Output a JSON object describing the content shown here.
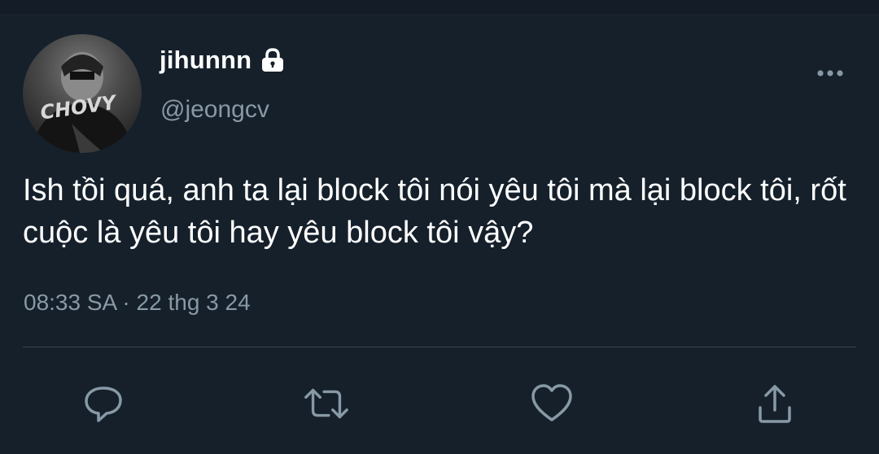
{
  "tweet": {
    "display_name": "jihunnn",
    "handle": "@jeongcv",
    "text": "Ish tồi quá, anh ta lại block tôi nói yêu tôi mà lại block tôi, rốt cuộc là yêu tôi hay yêu block tôi vậy?",
    "timestamp": "08:33 SA · 22 thg 3 24",
    "avatar_text": "CHOVY"
  },
  "icons": {
    "lock": "lock-icon",
    "more": "more-horizontal-icon",
    "reply": "reply-icon",
    "retweet": "retweet-icon",
    "like": "heart-icon",
    "share": "share-icon"
  },
  "colors": {
    "background": "#15202b",
    "secondary_text": "#8899a6",
    "divider": "#38444d"
  }
}
